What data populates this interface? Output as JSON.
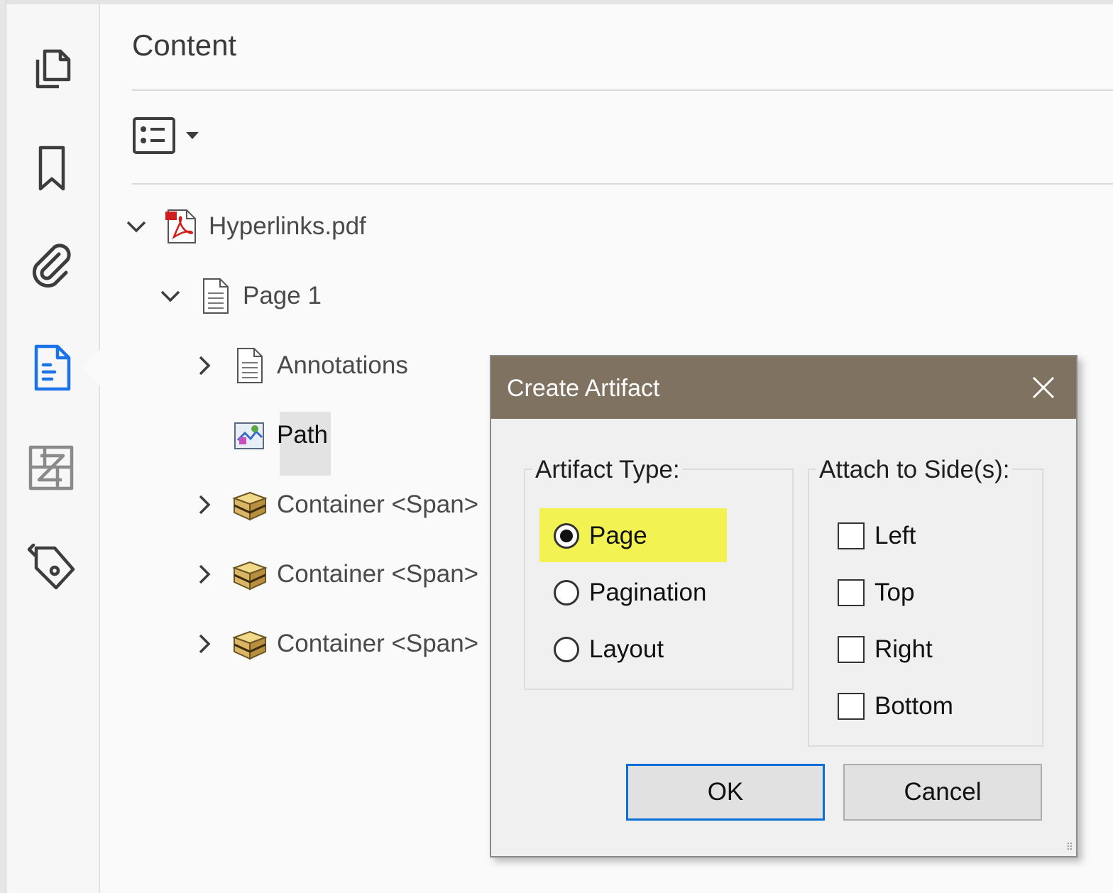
{
  "panel": {
    "title": "Content"
  },
  "nav": {
    "icons": [
      "pages-icon",
      "bookmark-icon",
      "attachment-icon",
      "content-icon",
      "order-icon",
      "tags-icon"
    ],
    "active": "content-icon",
    "accent": "#1a73e8"
  },
  "tree": {
    "items": [
      {
        "label": "Hyperlinks.pdf",
        "expanded": true,
        "icon": "pdf-file-icon"
      },
      {
        "label": "Page 1",
        "expanded": true,
        "icon": "page-icon"
      },
      {
        "label": "Annotations",
        "expanded": false,
        "icon": "page-icon"
      },
      {
        "label": "Path",
        "selected": true,
        "icon": "path-object-icon"
      },
      {
        "label": "Container <Span>",
        "expanded": false,
        "icon": "container-box-icon"
      },
      {
        "label": "Container <Span>",
        "expanded": false,
        "icon": "container-box-icon"
      },
      {
        "label": "Container <Span>",
        "expanded": false,
        "icon": "container-box-icon"
      }
    ]
  },
  "dialog": {
    "title": "Create Artifact",
    "title_bar_color": "#7f7260",
    "artifact_type": {
      "label": "Artifact Type:",
      "options": [
        "Page",
        "Pagination",
        "Layout"
      ],
      "selected": "Page",
      "highlight_color": "#f2f252"
    },
    "attach_sides": {
      "label": "Attach to Side(s):",
      "options": [
        "Left",
        "Top",
        "Right",
        "Bottom"
      ],
      "checked": []
    },
    "ok_label": "OK",
    "cancel_label": "Cancel"
  }
}
